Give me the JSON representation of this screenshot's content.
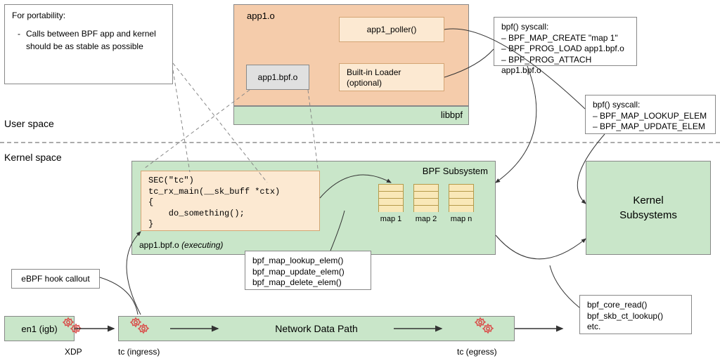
{
  "sections": {
    "user": "User space",
    "kernel": "Kernel space"
  },
  "app": {
    "title": "app1.o",
    "bpf_obj": "app1.bpf.o",
    "poller": "app1_poller()",
    "loader_l1": "Built-in Loader",
    "loader_l2": "(optional)",
    "libbpf": "libbpf"
  },
  "portability": {
    "title": "For portability:",
    "bullet": "Calls between BPF app and  kernel should be as stable as possible"
  },
  "bpf_sub": {
    "title": "BPF Subsystem",
    "exec_label": "app1.bpf.o (executing)",
    "code": "SEC(\"tc\")\ntc_rx_main(__sk_buff *ctx)\n{\n    do_something();\n}",
    "maps": {
      "m1": "map 1",
      "m2": "map 2",
      "mn": "map n"
    }
  },
  "kernel_sub": {
    "l1": "Kernel",
    "l2": "Subsystems"
  },
  "helpers_map": {
    "l1": "bpf_map_lookup_elem()",
    "l2": "bpf_map_update_elem()",
    "l3": "bpf_map_delete_elem()"
  },
  "helpers_kern": {
    "l1": "bpf_core_read()",
    "l2": "bpf_skb_ct_lookup()",
    "l3": "etc."
  },
  "syscall_load": {
    "title": "bpf() syscall:",
    "l1": "– BPF_MAP_CREATE \"map 1\"",
    "l2": "– BPF_PROG_LOAD app1.bpf.o",
    "l3": "– BPF_PROG_ATTACH app1.bpf.o"
  },
  "syscall_poll": {
    "title": "bpf() syscall:",
    "l1": "– BPF_MAP_LOOKUP_ELEM",
    "l2": "– BPF_MAP_UPDATE_ELEM"
  },
  "net": {
    "nic": "en1 (igb)",
    "xdp": "XDP",
    "tc_in": "tc (ingress)",
    "tc_out": "tc (egress)",
    "path": "Network Data Path",
    "hook": "eBPF hook callout"
  }
}
